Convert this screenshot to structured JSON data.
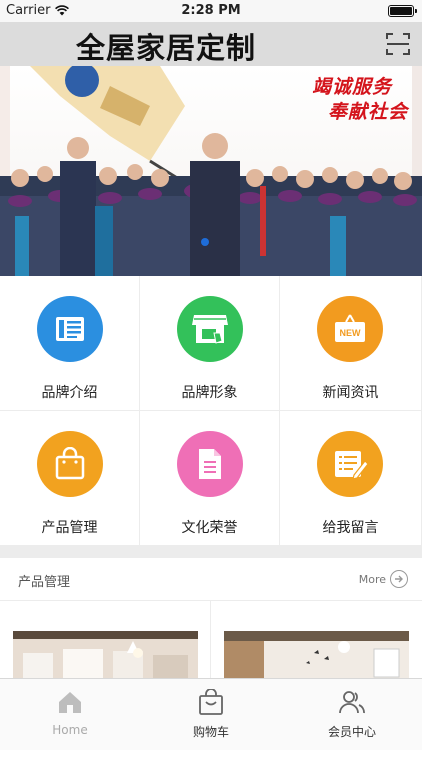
{
  "status_bar": {
    "carrier": "Carrier",
    "time": "2:28 PM"
  },
  "header": {
    "title": "全屋家居定制"
  },
  "banner": {
    "slogan_line1": "竭诚服务",
    "slogan_line2": "奉献社会"
  },
  "menu": [
    {
      "label": "品牌介绍",
      "icon": "newspaper-icon",
      "color": "#2b8fe0"
    },
    {
      "label": "品牌形象",
      "icon": "storefront-icon",
      "color": "#33c15a"
    },
    {
      "label": "新闻资讯",
      "icon": "new-badge-icon",
      "color": "#f29b1f"
    },
    {
      "label": "产品管理",
      "icon": "shopping-bag-icon",
      "color": "#f2a21f"
    },
    {
      "label": "文化荣誉",
      "icon": "document-icon",
      "color": "#ef6fb6"
    },
    {
      "label": "给我留言",
      "icon": "message-edit-icon",
      "color": "#f2a21f"
    }
  ],
  "section": {
    "title": "产品管理",
    "more": "More"
  },
  "tabbar": {
    "tabs": [
      {
        "label": "Home",
        "icon": "home-icon"
      },
      {
        "label": "购物车",
        "icon": "cart-bag-icon"
      },
      {
        "label": "会员中心",
        "icon": "members-icon"
      }
    ]
  }
}
